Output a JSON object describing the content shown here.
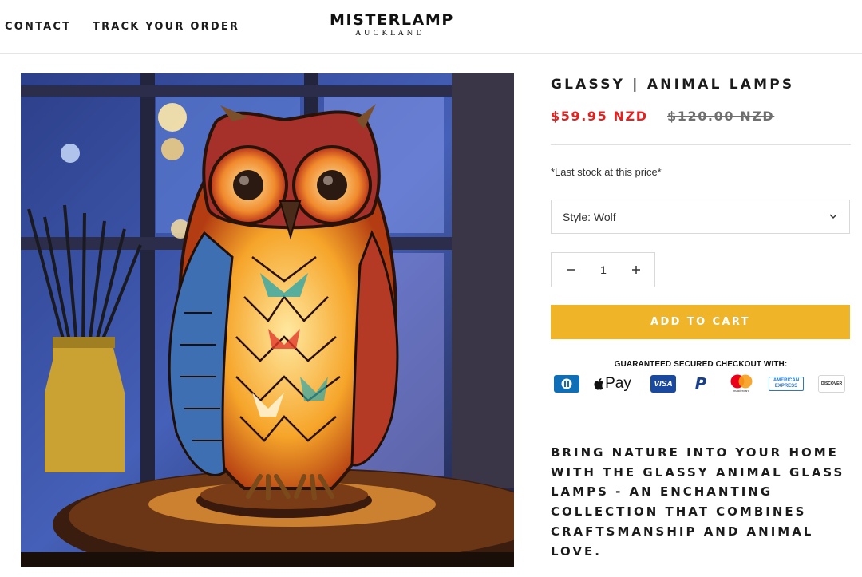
{
  "header": {
    "nav": [
      "CONTACT",
      "TRACK YOUR ORDER"
    ],
    "logo_main": "MISTERLAMP",
    "logo_sub": "AUCKLAND"
  },
  "product": {
    "title": "GLASSY | ANIMAL LAMPS",
    "price_sale": "$59.95 NZD",
    "price_compare": "$120.00 NZD",
    "stock_note": "*Last stock at this price*",
    "style_label": "Style: Wolf",
    "quantity": "1",
    "add_to_cart": "ADD TO CART",
    "checkout_heading": "GUARANTEED SECURED CHECKOUT WITH:",
    "description": "BRING NATURE INTO YOUR HOME WITH THE GLASSY ANIMAL GLASS LAMPS - AN ENCHANTING COLLECTION THAT COMBINES CRAFTSMANSHIP AND ANIMAL LOVE."
  },
  "payment_methods": [
    "diners-icon",
    "apple-pay-icon",
    "visa-icon",
    "paypal-icon",
    "mastercard-icon",
    "amex-icon",
    "discover-icon"
  ],
  "payment_text": {
    "apple_pay": "Pay",
    "visa": "VISA",
    "paypal": "P",
    "mastercard": "mastercard",
    "amex_line1": "AMERICAN",
    "amex_line2": "EXPRESS",
    "discover": "DISCOVER"
  },
  "colors": {
    "sale_price": "#e22120",
    "add_to_cart_bg": "#f0b429",
    "border": "#d9d9d9"
  }
}
